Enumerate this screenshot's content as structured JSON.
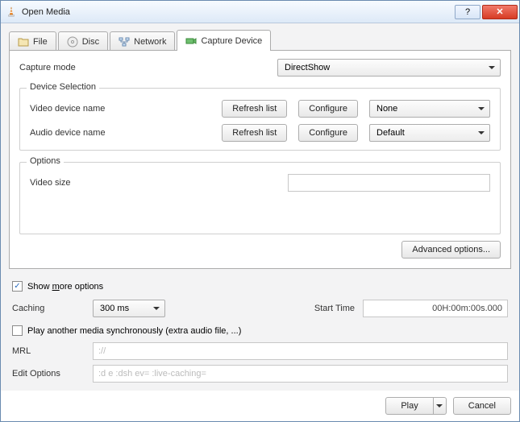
{
  "window": {
    "title": "Open Media"
  },
  "tabs": {
    "file": "File",
    "disc": "Disc",
    "network": "Network",
    "capture": "Capture Device"
  },
  "capture": {
    "mode_label": "Capture mode",
    "mode_value": "DirectShow",
    "device_selection_legend": "Device Selection",
    "video_device_label": "Video device name",
    "audio_device_label": "Audio device name",
    "refresh_label": "Refresh list",
    "configure_label": "Configure",
    "video_device_value": "None",
    "audio_device_value": "Default",
    "options_legend": "Options",
    "video_size_label": "Video size",
    "video_size_value": "",
    "advanced_label": "Advanced options..."
  },
  "more": {
    "show_more_label": "Show more options",
    "show_more_checked": true,
    "caching_label": "Caching",
    "caching_value": "300 ms",
    "start_time_label": "Start Time",
    "start_time_value": "00H:00m:00s.000",
    "play_sync_label": "Play another media synchronously (extra audio file, ...)",
    "play_sync_checked": false,
    "mrl_label": "MRL",
    "mrl_value": "://",
    "edit_options_label": "Edit Options",
    "edit_options_value": ":d                         e :dsh          ev=  :live-caching="
  },
  "footer": {
    "play": "Play",
    "cancel": "Cancel"
  }
}
